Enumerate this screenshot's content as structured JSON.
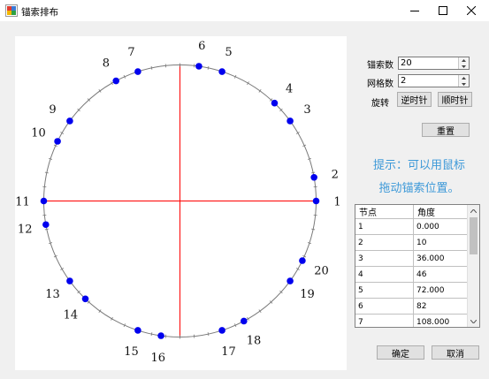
{
  "window": {
    "title": "锚索排布"
  },
  "diagram": {
    "nodes": [
      {
        "label": "1",
        "angle": 0
      },
      {
        "label": "2",
        "angle": 10
      },
      {
        "label": "3",
        "angle": 36
      },
      {
        "label": "4",
        "angle": 46
      },
      {
        "label": "5",
        "angle": 72
      },
      {
        "label": "6",
        "angle": 82
      },
      {
        "label": "7",
        "angle": 108
      },
      {
        "label": "8",
        "angle": 118
      },
      {
        "label": "9",
        "angle": 144
      },
      {
        "label": "10",
        "angle": 154
      },
      {
        "label": "11",
        "angle": 180
      },
      {
        "label": "12",
        "angle": 190
      },
      {
        "label": "13",
        "angle": 216
      },
      {
        "label": "14",
        "angle": 226
      },
      {
        "label": "15",
        "angle": 252
      },
      {
        "label": "16",
        "angle": 262
      },
      {
        "label": "17",
        "angle": 288
      },
      {
        "label": "18",
        "angle": 298
      },
      {
        "label": "19",
        "angle": 324
      },
      {
        "label": "20",
        "angle": 334
      }
    ],
    "colors": {
      "node": "#0000ee",
      "axis": "#ff0000",
      "circle": "#7a7a7a"
    }
  },
  "controls": {
    "anchor_count_label": "锚索数",
    "anchor_count_value": "20",
    "grid_count_label": "网格数",
    "grid_count_value": "2",
    "rotate_label": "旋转",
    "ccw_button": "逆时针",
    "cw_button": "顺时针",
    "reset_button": "重置"
  },
  "hint": {
    "line1": "提示：可以用鼠标",
    "line2": "拖动锚索位置。"
  },
  "table": {
    "headers": [
      "节点",
      "角度"
    ],
    "rows": [
      [
        "1",
        "0.000"
      ],
      [
        "2",
        "10"
      ],
      [
        "3",
        "36.000"
      ],
      [
        "4",
        "46"
      ],
      [
        "5",
        "72.000"
      ],
      [
        "6",
        "82"
      ],
      [
        "7",
        "108.000"
      ]
    ]
  },
  "footer": {
    "ok_button": "确定",
    "cancel_button": "取消"
  }
}
